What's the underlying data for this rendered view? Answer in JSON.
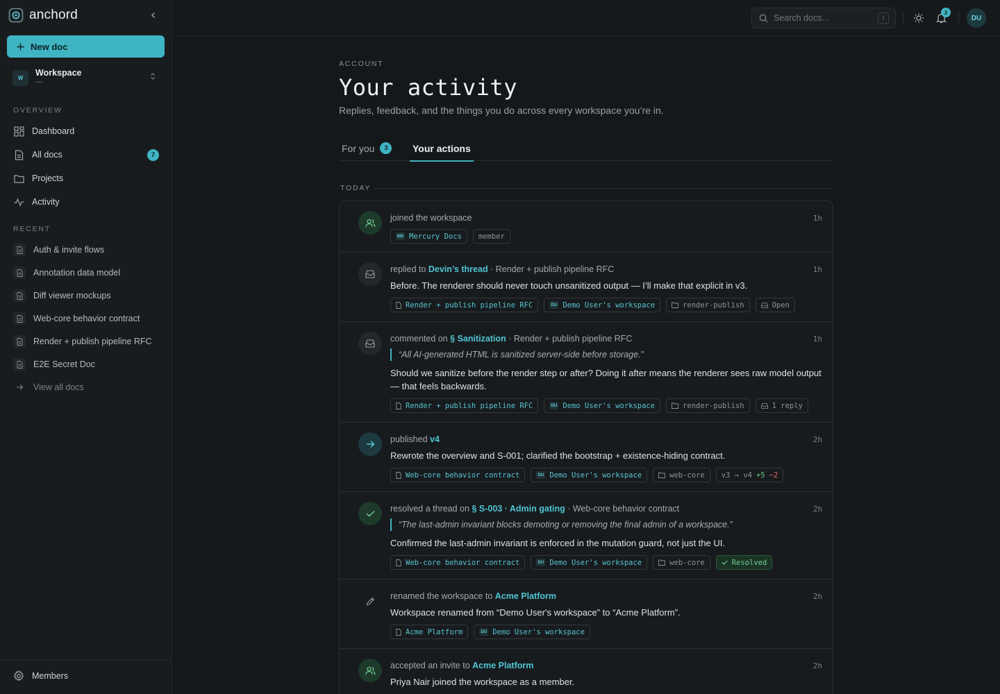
{
  "app": {
    "name": "anchord"
  },
  "sidebar": {
    "new_doc": "New doc",
    "workspace": {
      "initial": "W",
      "name": "Workspace",
      "sub": "—"
    },
    "overview_label": "OVERVIEW",
    "nav": [
      {
        "label": "Dashboard",
        "icon": "grid-icon"
      },
      {
        "label": "All docs",
        "icon": "doc-icon",
        "badge": "7"
      },
      {
        "label": "Projects",
        "icon": "folder-icon"
      },
      {
        "label": "Activity",
        "icon": "pulse-icon"
      }
    ],
    "recent_label": "RECENT",
    "recent": [
      "Auth & invite flows",
      "Annotation data model",
      "Diff viewer mockups",
      "Web-core behavior contract",
      "Render + publish pipeline RFC",
      "E2E Secret Doc"
    ],
    "view_all": "View all docs",
    "members": "Members"
  },
  "topbar": {
    "search_placeholder": "Search docs...",
    "search_key": "/",
    "notif_count": "3",
    "user_initials": "DU"
  },
  "page": {
    "eyebrow": "ACCOUNT",
    "title": "Your activity",
    "subtitle": "Replies, feedback, and the things you do across every workspace you’re in.",
    "tabs": [
      {
        "label": "For you",
        "badge": "3"
      },
      {
        "label": "Your actions"
      }
    ],
    "day_label": "TODAY"
  },
  "entries": [
    {
      "head_pre": "joined the workspace",
      "time": "1h",
      "chips": [
        {
          "mini": "MD",
          "text": "Mercury Docs",
          "style": "link"
        },
        {
          "text": "member"
        }
      ]
    },
    {
      "head_pre": "replied to ",
      "head_hl": "Devin’s thread",
      "head_post": " · Render + publish pipeline RFC",
      "time": "1h",
      "body": "Before. The renderer should never touch unsanitized output — I’ll make that explicit in v3.",
      "chips": [
        {
          "icon": "doc",
          "text": "Render + publish pipeline RFC",
          "style": "link"
        },
        {
          "mini": "DU",
          "text": "Demo User's workspace",
          "style": "link"
        },
        {
          "icon": "folder",
          "text": "render-publish"
        },
        {
          "icon": "inbox",
          "text": "Open"
        }
      ]
    },
    {
      "head_pre": "commented on ",
      "head_hl": "§ Sanitization",
      "head_post": " · Render + publish pipeline RFC",
      "time": "1h",
      "quote": "“All AI-generated HTML is sanitized server-side before storage.”",
      "body": "Should we sanitize before the render step or after? Doing it after means the renderer sees raw model output — that feels backwards.",
      "chips": [
        {
          "icon": "doc",
          "text": "Render + publish pipeline RFC",
          "style": "link"
        },
        {
          "mini": "DU",
          "text": "Demo User's workspace",
          "style": "link"
        },
        {
          "icon": "folder",
          "text": "render-publish"
        },
        {
          "icon": "inbox",
          "text": "1 reply"
        }
      ]
    },
    {
      "head_pre": "published ",
      "head_hl": "v4",
      "time": "2h",
      "body": "Rewrote the overview and S-001; clarified the bootstrap + existence-hiding contract.",
      "chips": [
        {
          "icon": "doc",
          "text": "Web-core behavior contract",
          "style": "link"
        },
        {
          "mini": "DU",
          "text": "Demo User's workspace",
          "style": "link"
        },
        {
          "icon": "folder",
          "text": "web-core"
        }
      ],
      "diff": {
        "from_to": "v3 → v4",
        "plus": "+5",
        "minus": "−2"
      }
    },
    {
      "head_pre": "resolved a thread on ",
      "head_hl": "§ S-003 · Admin gating",
      "head_post": " · Web-core behavior contract",
      "time": "2h",
      "quote": "“The last-admin invariant blocks demoting or removing the final admin of a workspace.”",
      "body": "Confirmed the last-admin invariant is enforced in the mutation guard, not just the UI.",
      "chips": [
        {
          "icon": "doc",
          "text": "Web-core behavior contract",
          "style": "link"
        },
        {
          "mini": "DU",
          "text": "Demo User's workspace",
          "style": "link"
        },
        {
          "icon": "folder",
          "text": "web-core"
        },
        {
          "icon": "check",
          "text": "Resolved",
          "style": "resolved"
        }
      ]
    },
    {
      "head_pre": "renamed the workspace to ",
      "head_hl": "Acme Platform",
      "time": "2h",
      "body": "Workspace renamed from “Demo User's workspace” to “Acme Platform”.",
      "chips": [
        {
          "icon": "doc",
          "text": "Acme Platform",
          "style": "link"
        },
        {
          "mini": "DU",
          "text": "Demo User's workspace",
          "style": "link"
        }
      ]
    },
    {
      "head_pre": "accepted an invite to ",
      "head_hl": "Acme Platform",
      "time": "2h",
      "body": "Priya Nair joined the workspace as a member."
    }
  ]
}
